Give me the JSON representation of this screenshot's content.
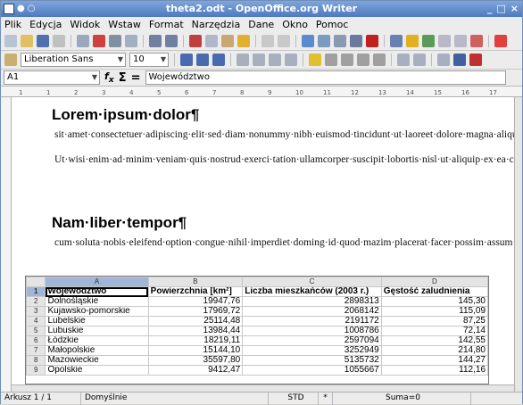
{
  "window": {
    "title": "theta2.odt - OpenOffice.org Writer",
    "controls": [
      "_",
      "□",
      "×"
    ]
  },
  "menu": [
    {
      "label": "Plik"
    },
    {
      "label": "Edycja"
    },
    {
      "label": "Widok"
    },
    {
      "label": "Wstaw"
    },
    {
      "label": "Format"
    },
    {
      "label": "Narzędzia"
    },
    {
      "label": "Dane"
    },
    {
      "label": "Okno"
    },
    {
      "label": "Pomoc"
    }
  ],
  "toolbar2": {
    "font_name": "Liberation Sans",
    "font_size": "10"
  },
  "formula": {
    "cell_ref": "A1",
    "content": "Województwo"
  },
  "ruler_numbers": [
    "1",
    "1",
    "2",
    "3",
    "4",
    "5",
    "6",
    "7",
    "8",
    "9",
    "10",
    "11",
    "12",
    "13",
    "14",
    "15",
    "16",
    "17"
  ],
  "document": {
    "heading1": "Lorem·ipsum·dolor¶",
    "para1": "sit·amet·consectetuer·adipiscing·elit·sed·diam·nonummy·nibh·euismod·tincidunt·ut·laoreet·dolore·magna·aliquam·erat·volutpat¶",
    "para2": "Ut·wisi·enim·ad·minim·veniam·quis·nostrud·exerci·tation·ullamcorper·suscipit·lobortis·nisl·ut·aliquip·ex·ea·commodo·consequat·Duis·autem·vel·eum·iriure·dolor·in·hendrerit·in·vulputate·velit·esse·molestie·consequat·vel·illum·dolore·eu·feugiat·nulla·facilisis·at·vero·eros·et·accumsan·et·iusto·odio·dignissim·qui·blandit·praesent·luptatum·zzril·delenit·augue·duis·dolore·te·feugait·nulla·facilisi·¶",
    "heading2": "Nam·liber·tempor¶",
    "para3": "cum·soluta·nobis·eleifend·option·congue·nihil·imperdiet·doming·id·quod·mazim·placerat·facer·possim·assum·Typi·non·habent·claritatem·insitam;·est·usus·legentis·in·iis·qui·facit·eorum·claritatem·Investigationes·demonstraverunt·lectores·legere·me·lius·quod·ii·legunt·saepius·¶"
  },
  "spreadsheet": {
    "columns": [
      "A",
      "B",
      "C",
      "D"
    ],
    "rows": [
      {
        "n": "1",
        "a": "Województwo",
        "b": "Powierzchnia [km²]",
        "c": "Liczba mieszkańców (2003 r.)",
        "d": "Gęstość zaludnienia"
      },
      {
        "n": "2",
        "a": "Dolnośląskie",
        "b": "19947,76",
        "c": "2898313",
        "d": "145,30"
      },
      {
        "n": "3",
        "a": "Kujawsko-pomorskie",
        "b": "17969,72",
        "c": "2068142",
        "d": "115,09"
      },
      {
        "n": "4",
        "a": "Lubelskie",
        "b": "25114,48",
        "c": "2191172",
        "d": "87,25"
      },
      {
        "n": "5",
        "a": "Lubuskie",
        "b": "13984,44",
        "c": "1008786",
        "d": "72,14"
      },
      {
        "n": "6",
        "a": "Łódzkie",
        "b": "18219,11",
        "c": "2597094",
        "d": "142,55"
      },
      {
        "n": "7",
        "a": "Małopolskie",
        "b": "15144,10",
        "c": "3252949",
        "d": "214,80"
      },
      {
        "n": "8",
        "a": "Mazowieckie",
        "b": "35597,80",
        "c": "5135732",
        "d": "144,27"
      },
      {
        "n": "9",
        "a": "Opolskie",
        "b": "9412,47",
        "c": "1055667",
        "d": "112,16"
      }
    ]
  },
  "statusbar": {
    "sheet": "Arkusz 1 / 1",
    "style": "Domyślnie",
    "mode": "STD",
    "star": "*",
    "sum": "Suma=0"
  }
}
